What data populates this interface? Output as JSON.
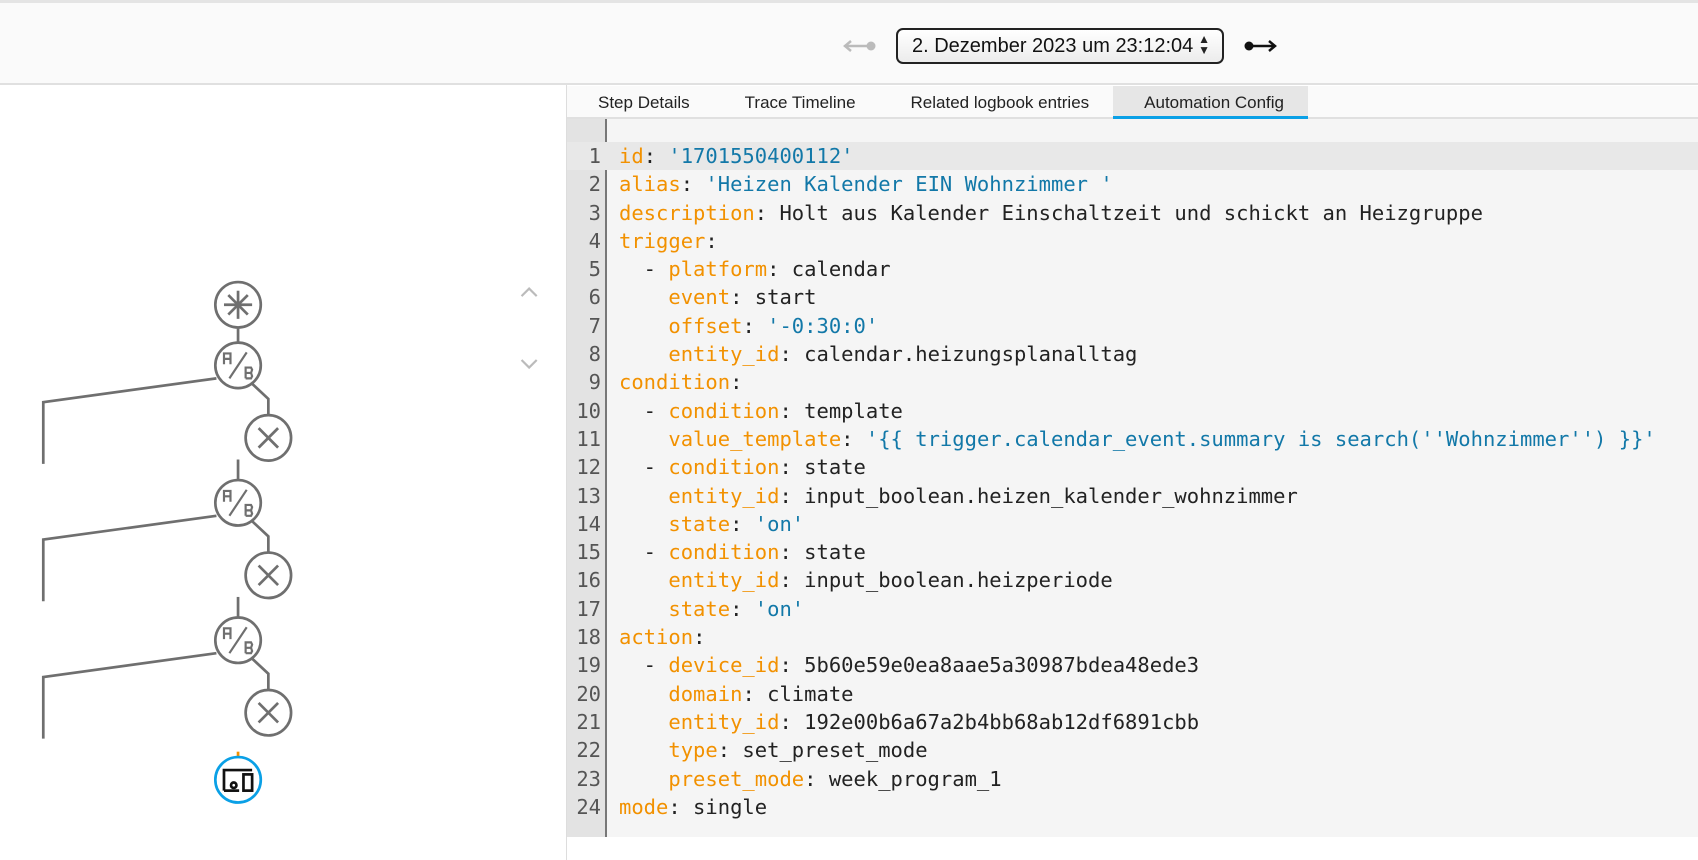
{
  "header": {
    "trace_select_value": "2. Dezember 2023 um 23:12:04",
    "prev_icon": "arrow-left-dot-icon",
    "next_icon": "arrow-right-dot-icon"
  },
  "tabs": [
    {
      "label": "Step Details",
      "active": false
    },
    {
      "label": "Trace Timeline",
      "active": false
    },
    {
      "label": "Related logbook entries",
      "active": false
    },
    {
      "label": "Automation Config",
      "active": true
    }
  ],
  "graph": {
    "nodes": [
      "trigger-icon",
      "choose-icon",
      "condition-failed-icon",
      "choose-icon",
      "condition-failed-icon",
      "choose-icon",
      "condition-failed-icon",
      "device-action-icon"
    ],
    "accent": "#0aa0e6",
    "active_path": "#f29100"
  },
  "code": {
    "lines": [
      [
        {
          "t": "id",
          "c": "k"
        },
        {
          "t": ": "
        },
        {
          "t": "'1701550400112'",
          "c": "s"
        }
      ],
      [
        {
          "t": "alias",
          "c": "k"
        },
        {
          "t": ": "
        },
        {
          "t": "'Heizen Kalender EIN Wohnzimmer '",
          "c": "s"
        }
      ],
      [
        {
          "t": "description",
          "c": "k"
        },
        {
          "t": ": Holt aus Kalender Einschaltzeit und schickt an Heizgruppe"
        }
      ],
      [
        {
          "t": "trigger",
          "c": "k"
        },
        {
          "t": ":"
        }
      ],
      [
        {
          "t": "  - "
        },
        {
          "t": "platform",
          "c": "k"
        },
        {
          "t": ": calendar"
        }
      ],
      [
        {
          "t": "    "
        },
        {
          "t": "event",
          "c": "k"
        },
        {
          "t": ": start"
        }
      ],
      [
        {
          "t": "    "
        },
        {
          "t": "offset",
          "c": "k"
        },
        {
          "t": ": "
        },
        {
          "t": "'-0:30:0'",
          "c": "s"
        }
      ],
      [
        {
          "t": "    "
        },
        {
          "t": "entity_id",
          "c": "k"
        },
        {
          "t": ": calendar.heizungsplanalltag"
        }
      ],
      [
        {
          "t": "condition",
          "c": "k"
        },
        {
          "t": ":"
        }
      ],
      [
        {
          "t": "  - "
        },
        {
          "t": "condition",
          "c": "k"
        },
        {
          "t": ": template"
        }
      ],
      [
        {
          "t": "    "
        },
        {
          "t": "value_template",
          "c": "k"
        },
        {
          "t": ": "
        },
        {
          "t": "'{{ trigger.calendar_event.summary is search(''Wohnzimmer'') }}'",
          "c": "s"
        }
      ],
      [
        {
          "t": "  - "
        },
        {
          "t": "condition",
          "c": "k"
        },
        {
          "t": ": state"
        }
      ],
      [
        {
          "t": "    "
        },
        {
          "t": "entity_id",
          "c": "k"
        },
        {
          "t": ": input_boolean.heizen_kalender_wohnzimmer"
        }
      ],
      [
        {
          "t": "    "
        },
        {
          "t": "state",
          "c": "k"
        },
        {
          "t": ": "
        },
        {
          "t": "'on'",
          "c": "s"
        }
      ],
      [
        {
          "t": "  - "
        },
        {
          "t": "condition",
          "c": "k"
        },
        {
          "t": ": state"
        }
      ],
      [
        {
          "t": "    "
        },
        {
          "t": "entity_id",
          "c": "k"
        },
        {
          "t": ": input_boolean.heizperiode"
        }
      ],
      [
        {
          "t": "    "
        },
        {
          "t": "state",
          "c": "k"
        },
        {
          "t": ": "
        },
        {
          "t": "'on'",
          "c": "s"
        }
      ],
      [
        {
          "t": "action",
          "c": "k"
        },
        {
          "t": ":"
        }
      ],
      [
        {
          "t": "  - "
        },
        {
          "t": "device_id",
          "c": "k"
        },
        {
          "t": ": 5b60e59e0ea8aae5a30987bdea48ede3"
        }
      ],
      [
        {
          "t": "    "
        },
        {
          "t": "domain",
          "c": "k"
        },
        {
          "t": ": climate"
        }
      ],
      [
        {
          "t": "    "
        },
        {
          "t": "entity_id",
          "c": "k"
        },
        {
          "t": ": 192e00b6a67a2b4bb68ab12df6891cbb"
        }
      ],
      [
        {
          "t": "    "
        },
        {
          "t": "type",
          "c": "k"
        },
        {
          "t": ": set_preset_mode"
        }
      ],
      [
        {
          "t": "    "
        },
        {
          "t": "preset_mode",
          "c": "k"
        },
        {
          "t": ": week_program_1"
        }
      ],
      [
        {
          "t": "mode",
          "c": "k"
        },
        {
          "t": ": single"
        }
      ]
    ]
  }
}
